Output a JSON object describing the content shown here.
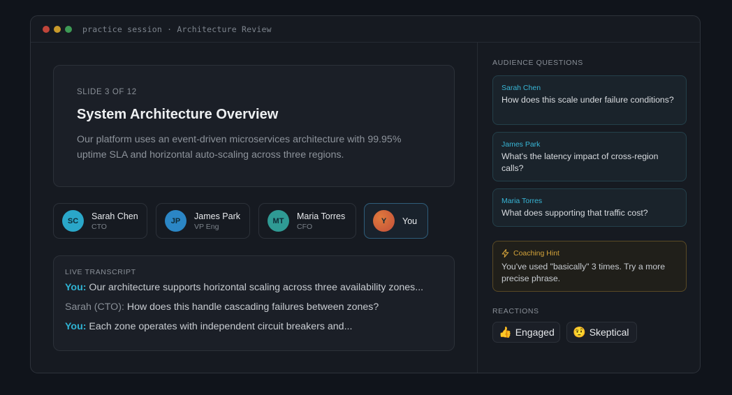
{
  "window": {
    "title": "practice session · Architecture Review"
  },
  "slide": {
    "counter": "SLIDE 3 OF 12",
    "title": "System Architecture Overview",
    "body": "Our platform uses an event-driven microservices architecture with 99.95% uptime SLA and horizontal auto-scaling across three regions."
  },
  "participants": [
    {
      "initials": "SC",
      "name": "Sarah Chen",
      "role": "CTO",
      "color": "#2aa7c9"
    },
    {
      "initials": "JP",
      "name": "James Park",
      "role": "VP Eng",
      "color": "#2b86c5"
    },
    {
      "initials": "MT",
      "name": "Maria Torres",
      "role": "CFO",
      "color": "#2f9a94"
    },
    {
      "initials": "Y",
      "name": "You",
      "role": "",
      "color": "#d4683a"
    }
  ],
  "transcript": {
    "label": "LIVE TRANSCRIPT",
    "lines": [
      {
        "speaker": "You:",
        "text": " Our architecture supports horizontal scaling across three availability zones..."
      },
      {
        "speaker": "Sarah (CTO):",
        "text": " How does this handle cascading failures between zones?"
      },
      {
        "speaker": "You:",
        "text": " Each zone operates with independent circuit breakers and..."
      }
    ]
  },
  "questions": {
    "label": "AUDIENCE QUESTIONS",
    "items": [
      {
        "name": "Sarah Chen",
        "text": "How does this scale under failure conditions?"
      },
      {
        "name": "James Park",
        "text": "What's the latency impact of cross-region calls?"
      },
      {
        "name": "Maria Torres",
        "text": "What does supporting that traffic cost?"
      }
    ]
  },
  "hint": {
    "title": "Coaching Hint",
    "text": "You've used \"basically\" 3 times. Try a more precise phrase."
  },
  "reactions": {
    "label": "REACTIONS",
    "items": [
      {
        "emoji": "👍",
        "label": "Engaged"
      },
      {
        "emoji": "🤨",
        "label": "Skeptical"
      }
    ]
  },
  "colors": {
    "accent": "#2fb3d3",
    "hint": "#d4a33a"
  }
}
